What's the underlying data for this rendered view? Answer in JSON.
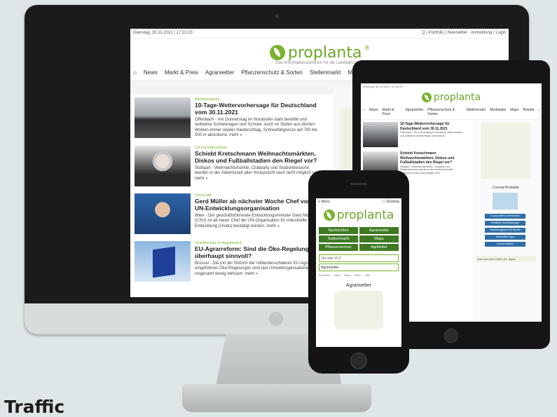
{
  "caption": "Traffic",
  "desktop": {
    "topline_left": "Dienstag, 30.11.2021 | 17:10:23",
    "topline_right": "Q | Portfolio | Newsletter · Anmeldung / Login",
    "brand": "proplanta",
    "reg": "®",
    "tagline": "Das Informationszentrum für die Landwirtschaft",
    "nav": [
      "News",
      "Markt & Preis",
      "Agrarwetter",
      "Pflanzenschutz & Sorten",
      "Stellenmarkt",
      "Marktplatz"
    ],
    "articles": [
      {
        "category": "Wetterprognose",
        "title": "10-Tage-Wettervorhersage für Deutschland vom 30.11.2021",
        "text": "Offenbach - Am Donnerstag im Nordosten stark bewölkt und zeitweise Schneeregen und Schnee. Auch im Süden aus dichten Wolken immer wieder Niederschlag, Schneefallgrenze auf 700 bis 500 m absinkend. mehr »"
      },
      {
        "category": "Corona-Maßnahmen",
        "title": "Schiebt Kretschmann Weihnachtsmärkten, Diskos und Fußballstadien den Riegel vor?",
        "text": "Stuttgart - Weihnachtsmärkte, Clubparty und Stadionbesuche werden in der Adventszeit aller Voraussicht nach nicht möglich sein. mehr »"
      },
      {
        "category": "Personalie",
        "title": "Gerd Müller ab nächster Woche Chef von UN-Entwicklungsorganisation",
        "text": "Wien - Der geschäftsführende Entwicklungsminister Gerd Müller (CSU) ist ab neuer Chef der UN-Organisation für industrielle Entwicklung (Unido) bestätigt worden. mehr »"
      },
      {
        "category": "Umweltschutz im Agrarbereich",
        "title": "EU-Agrarreform: Sind die Öko-Regelungen überhaupt sinnvoll?",
        "text": "Brüssel - Die mit der Reform der milliardenschweren EU-Agrarpolitik eingeführten Öko-Regelungen sind laut Umweltorganisationen insgesamt wenig wirksam. mehr »"
      }
    ]
  },
  "tablet": {
    "topline": "Dienstag, 30.11.2021 | 17:10:23",
    "brand": "proplanta",
    "nav": [
      "News",
      "Markt & Preis",
      "Agrarwetter",
      "Pflanzenschutz & Sorten",
      "Stellenmarkt",
      "Marktplatz",
      "Maps",
      "Betrieb"
    ],
    "articles": [
      {
        "title": "10-Tage-Wettervorhersage für Deutschland vom 30.11.2021",
        "text": "Offenbach - Am Donnerstag im Nordosten stark bewölkt und zeitweise Schneeregen und Schnee."
      },
      {
        "title": "Schiebt Kretschmann Weihnachtsmärkten, Diskos und Fußballstadien den Riegel vor?",
        "text": "Stuttgart - Weihnachtsmärkte, Clubparty und Stadionbesuche werden in der Adventszeit aller Voraussicht nach nicht möglich sein."
      }
    ],
    "side_title": "Corona-Produkte",
    "side_buttons": [
      "Corona-Hilfen Unternehmen",
      "Kreditfreie Weiterbildungen",
      "Impfmanagement für Betrieb",
      "Homeoffice Tipps",
      "Corona-Hotlines"
    ],
    "side_note": "Unternehmen erlebt des Tages"
  },
  "phone": {
    "menu_label": "Menü",
    "desktop_label": "Desktop",
    "brand": "proplanta",
    "grid": [
      "Nachrichten",
      "Agrarwetter",
      "Stellenmarkt",
      "Maps",
      "Pflanzenschutz",
      "Agrifinder"
    ],
    "search_placeholder": "Ort oder PLZ",
    "search_value": "Agrarwetter",
    "share": [
      "Favoriten",
      "teilen",
      "tweet",
      "teilen",
      "mail"
    ],
    "weather_title": "Agrarwetter"
  }
}
